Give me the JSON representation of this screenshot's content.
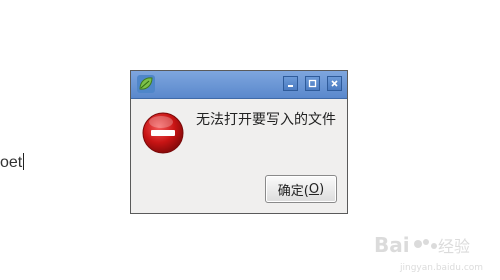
{
  "background_text": "oet",
  "dialog": {
    "message": "无法打开要写入的文件",
    "ok_label": "确定(",
    "ok_mnemonic": "O",
    "ok_suffix": ")",
    "icons": {
      "app": "leaf-app-icon",
      "error": "error-stop-icon",
      "minimize": "minimize-icon",
      "maximize": "maximize-icon",
      "close": "close-icon"
    },
    "colors": {
      "titlebar": "#6b95d4",
      "error_red": "#c81414",
      "dialog_bg": "#f0efee"
    }
  },
  "watermark": {
    "text": "Baidu 经验",
    "url_text": "jingyan.baidu.com"
  }
}
